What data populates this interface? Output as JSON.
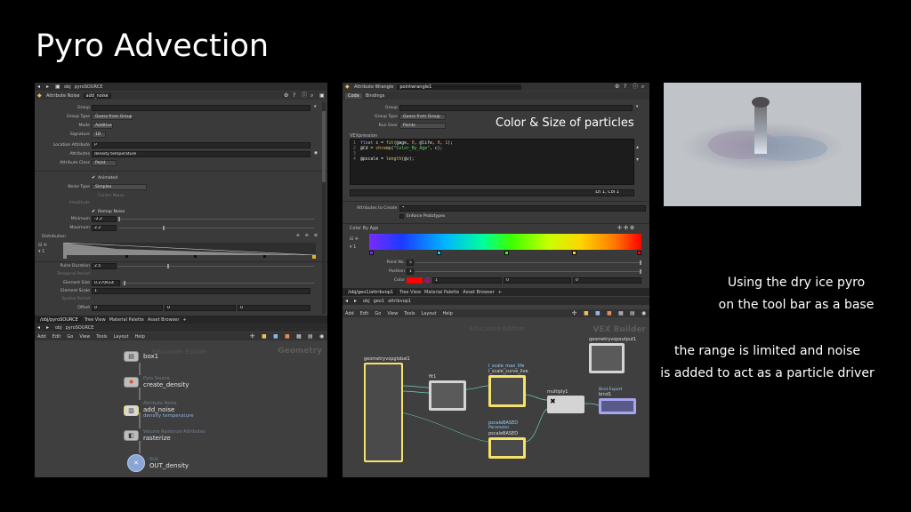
{
  "slide": {
    "title": "Pyro Advection",
    "caption_lines": [
      "Using the dry ice pyro",
      "on the tool bar as a base",
      "the range is limited and noise",
      "is added to act as a particle driver"
    ],
    "overlay_label": "Color & Size of particles"
  },
  "left_params": {
    "path_obj": "obj",
    "path_node": "pyroSOURCE",
    "node_type": "Attribute Noise",
    "node_name": "add_noise",
    "rows": [
      {
        "label": "Group",
        "value": ""
      },
      {
        "label": "Group Type",
        "value": "Guess from Group"
      },
      {
        "label": "Mode",
        "value": "Additive"
      },
      {
        "label": "Signature",
        "value": "1D"
      },
      {
        "label": "Location Attribute",
        "value": "P"
      },
      {
        "label": "Attributes",
        "value": "density temperature"
      },
      {
        "label": "Attribute Class",
        "value": "Point"
      },
      {
        "label": "Animated",
        "value": ""
      },
      {
        "label": "Noise Type",
        "value": "Simplex"
      },
      {
        "label": "Center Noise",
        "value": ""
      },
      {
        "label": "Amplitude",
        "value": ""
      },
      {
        "label": "Remap Noise",
        "value": ""
      },
      {
        "label": "Minimum",
        "value": "-2.2"
      },
      {
        "label": "Maximum",
        "value": "2.2"
      },
      {
        "label": "Distribution",
        "value": ""
      },
      {
        "label": "Pulse Duration",
        "value": "2.5"
      },
      {
        "label": "Temporal Period",
        "value": ""
      },
      {
        "label": "Element Size",
        "value": "0.270614"
      },
      {
        "label": "Element Scale",
        "value": "1"
      },
      {
        "label": "Spatial Period",
        "value": ""
      },
      {
        "label": "Offset",
        "value": "0"
      }
    ]
  },
  "left_net": {
    "tabs": [
      "/obj/pyroSOURCE",
      "Tree View",
      "Material Palette",
      "Asset Browser"
    ],
    "path_obj": "obj",
    "path_node": "pyroSOURCE",
    "menu": [
      "Add",
      "Edit",
      "Go",
      "View",
      "Tools",
      "Layout",
      "Help"
    ],
    "watermark": "Geometry",
    "edition": "Education Edition",
    "nodes": [
      {
        "type": "",
        "name": "box1",
        "sub": ""
      },
      {
        "type": "Pyro Source",
        "name": "create_density",
        "sub": ""
      },
      {
        "type": "Attribute Noise",
        "name": "add_noise",
        "sub": "density temperature"
      },
      {
        "type": "Volume Rasterize Attributes",
        "name": "rasterize",
        "sub": ""
      },
      {
        "type": "Null",
        "name": "OUT_density",
        "sub": ""
      }
    ]
  },
  "right_params": {
    "node_type": "Attribute Wrangle",
    "node_name": "pointwrangle1",
    "tabs": [
      "Code",
      "Bindings"
    ],
    "group_label": "Group",
    "group_type_label": "Group Type",
    "group_type_value": "Guess from Group",
    "run_over_label": "Run Over",
    "run_over_value": "Points",
    "vex_label": "VEXpression",
    "code": [
      "float c = fit(@age, 0, @life, 0, 1);",
      "@Cd = chramp(\"Color_By_Age\", c);",
      "",
      "@pscale = length(@v);"
    ],
    "cursor_status": "Ln 1, Col 1",
    "attr_create_label": "Attributes to Create",
    "attr_create_value": "*",
    "enforce_label": "Enforce Prototypes",
    "ramp_label": "Color By Age",
    "point_no_label": "Point No.",
    "point_no_value": "5",
    "position_label": "Position",
    "position_value": "1",
    "color_label": "Color",
    "color_values": [
      "1",
      "0",
      "0"
    ]
  },
  "right_net": {
    "tabs": [
      "/obj/geo1/attribvop1",
      "Tree View",
      "Material Palette",
      "Asset Browser"
    ],
    "path_obj": "obj",
    "path_geo": "geo1",
    "path_node": "attribvop1",
    "menu": [
      "Add",
      "Edit",
      "Go",
      "View",
      "Tools",
      "Layout",
      "Help"
    ],
    "edition": "Education Edition",
    "watermark": "VEX Builder",
    "nodes": {
      "geovop_in": "geometryvopglobal1",
      "geovop_out": "geometryvopoutput1",
      "fit": "fit1",
      "scale_max": "l_scale_max_life",
      "scale_curve": "l_scale_curve_live",
      "multiply": "multiply1",
      "bind_type": "Bind Export",
      "bind": "bind1",
      "pscale_type": "pscaleBASED",
      "pscale": "pscaleBASED",
      "pscale_sub": "Parameter"
    }
  },
  "colors": {
    "bg": "#000000",
    "panel": "#3a3a3a",
    "bar": "#2c2c2c",
    "accent_yellow": "#f4e26a",
    "accent_purple": "#a8a4ef"
  }
}
